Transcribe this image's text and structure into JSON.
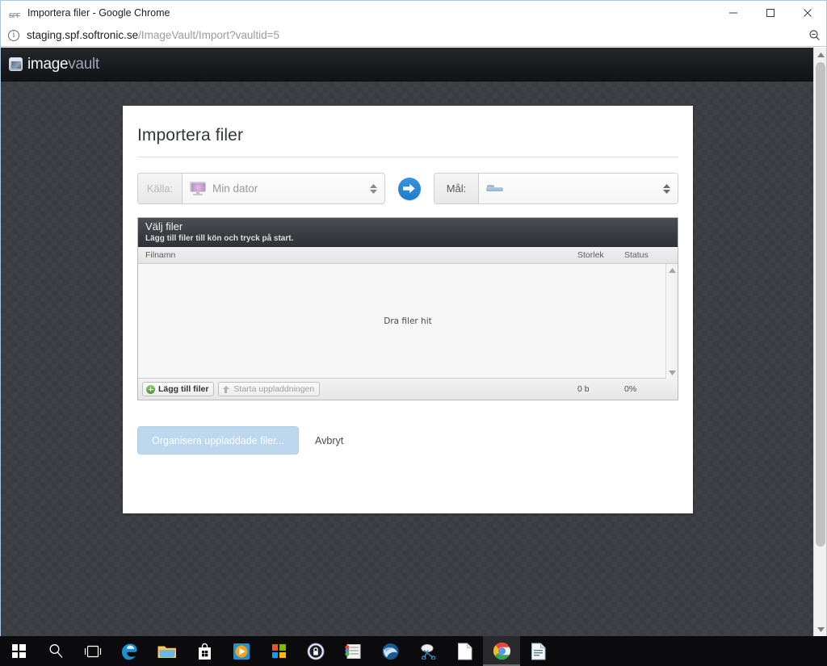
{
  "browser": {
    "tab_title": "Importera filer - Google Chrome",
    "favicon_label": "SPF",
    "url_host": "staging.spf.softronic.se",
    "url_path": "/ImageVault/Import?vaultid=5",
    "info_icon": "info-icon",
    "zoom_icon": "zoom-out-icon",
    "minimize_label": "Minimize",
    "maximize_label": "Maximize",
    "close_label": "Close"
  },
  "site_header": {
    "logo_part1": "image",
    "logo_part2": "vault"
  },
  "dialog": {
    "title": "Importera filer",
    "source": {
      "label": "Källa:",
      "value": "Min dator",
      "icon": "monitor-icon"
    },
    "go_button_icon": "arrow-right-icon",
    "target": {
      "label": "Mål:",
      "value": "",
      "icon": "folder-icon"
    },
    "uploader": {
      "heading": "Välj filer",
      "subheading": "Lägg till filer till kön och tryck på start.",
      "columns": {
        "filename": "Filnamn",
        "size": "Storlek",
        "status": "Status"
      },
      "rows": [],
      "dropzone_text": "Dra filer hit",
      "add_files_label": "Lägg till filer",
      "start_upload_label": "Starta uppladdningen",
      "total_size": "0 b",
      "total_percent": "0%"
    },
    "actions": {
      "primary_label": "Organisera uppladdade filer...",
      "cancel_label": "Avbryt"
    }
  },
  "colors": {
    "accent_blue": "#2080cf",
    "primary_disabled": "#bcd7ee",
    "header_dark": "#1c1d21",
    "page_bg": "#3b3c42"
  },
  "taskbar": {
    "items": [
      {
        "name": "start-button",
        "icon": "windows-logo-icon"
      },
      {
        "name": "search-button",
        "icon": "search-icon"
      },
      {
        "name": "task-view-button",
        "icon": "task-view-icon"
      },
      {
        "name": "edge-button",
        "icon": "edge-icon"
      },
      {
        "name": "file-explorer-button",
        "icon": "folder-icon"
      },
      {
        "name": "microsoft-store-button",
        "icon": "store-bag-icon"
      },
      {
        "name": "media-player-button",
        "icon": "play-icon"
      },
      {
        "name": "office-button",
        "icon": "microsoft-logo-icon"
      },
      {
        "name": "password-manager-button",
        "icon": "lock-icon"
      },
      {
        "name": "app-button",
        "icon": "colored-list-icon"
      },
      {
        "name": "thunderbird-button",
        "icon": "bird-icon"
      },
      {
        "name": "snipping-tool-button",
        "icon": "scissors-icon"
      },
      {
        "name": "document-button",
        "icon": "blank-page-icon"
      },
      {
        "name": "chrome-button",
        "icon": "chrome-icon"
      },
      {
        "name": "writer-button",
        "icon": "text-document-icon"
      }
    ]
  }
}
